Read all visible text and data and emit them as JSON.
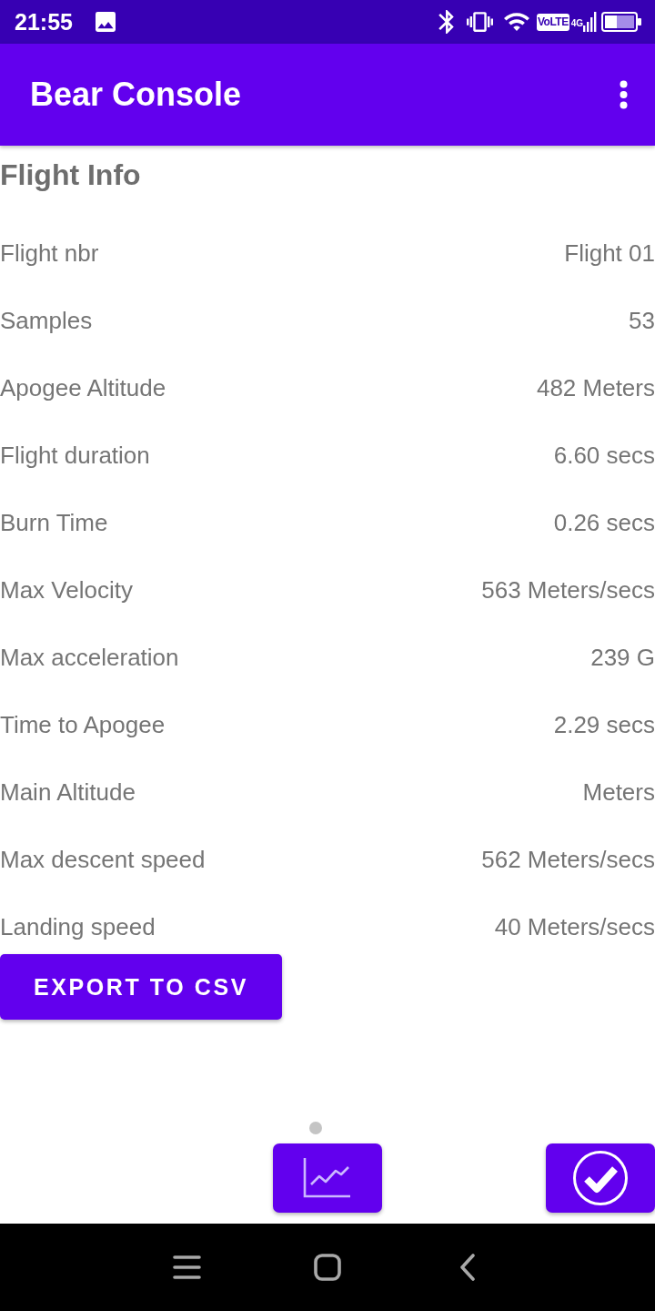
{
  "status_bar": {
    "time": "21:55",
    "volte": "VoLTE",
    "network": "4G"
  },
  "app_bar": {
    "title": "Bear Console"
  },
  "section": {
    "title": "Flight Info"
  },
  "rows": [
    {
      "label": "Flight nbr",
      "value": "Flight 01"
    },
    {
      "label": "Samples",
      "value": "53"
    },
    {
      "label": "Apogee Altitude",
      "value": "482 Meters"
    },
    {
      "label": "Flight duration",
      "value": "6.60 secs"
    },
    {
      "label": "Burn Time",
      "value": "0.26 secs"
    },
    {
      "label": "Max Velocity",
      "value": "563 Meters/secs"
    },
    {
      "label": "Max acceleration",
      "value": "239 G"
    },
    {
      "label": "Time to Apogee",
      "value": "2.29 secs"
    },
    {
      "label": "Main Altitude",
      "value": "Meters"
    },
    {
      "label": "Max descent speed",
      "value": "562 Meters/secs"
    },
    {
      "label": "Landing speed",
      "value": "40 Meters/secs"
    }
  ],
  "export_button": {
    "label": "EXPORT TO CSV"
  },
  "bottom_buttons": [
    {
      "kind": "chart"
    },
    {
      "kind": "confirm"
    }
  ]
}
